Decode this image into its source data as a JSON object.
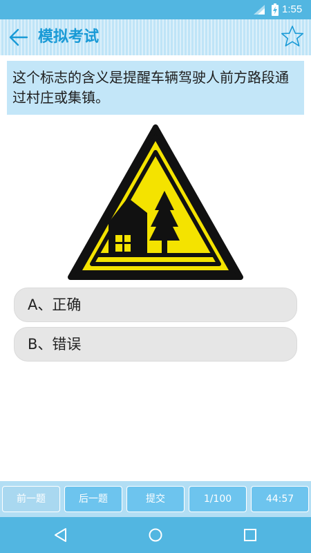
{
  "status_bar": {
    "time": "1:55",
    "icons": [
      "signal-icon",
      "battery-charging-icon"
    ]
  },
  "app_bar": {
    "title": "模拟考试",
    "back_icon": "back-arrow-icon",
    "favorite_icon": "star-outline-icon"
  },
  "question": {
    "text": "这个标志的含义是提醒车辆驾驶人前方路段通过村庄或集镇。"
  },
  "sign": {
    "icon": "village-warning-sign",
    "colors": {
      "fill": "#f4e300",
      "border": "#111111"
    }
  },
  "options": [
    {
      "label": "A、正确"
    },
    {
      "label": "B、错误"
    }
  ],
  "toolbar": {
    "prev_label": "前一题",
    "next_label": "后一题",
    "submit_label": "提交",
    "progress_label": "1/100",
    "timer_label": "44:57"
  },
  "nav_bar": {
    "icons": [
      "nav-back-icon",
      "nav-home-icon",
      "nav-recent-icon"
    ]
  },
  "colors": {
    "primary": "#52b6e1",
    "title_text": "#199ad6",
    "question_bg": "#c3e6f8",
    "option_bg": "#e6e6e6",
    "toolbar_button": "#6dc4ee"
  }
}
